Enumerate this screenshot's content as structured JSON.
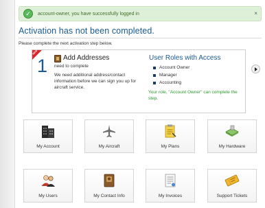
{
  "alert": {
    "message": "account-owner, you have successfully logged in",
    "close": "×"
  },
  "page": {
    "title": "Activation has not been completed.",
    "instruction": "Please complete the next activation step below."
  },
  "step": {
    "badge": "NEW",
    "number": "1",
    "title": "Add Addresses",
    "need": "need to complete",
    "description": "We need additional address/contact information before we can sign you up for aircraft service.",
    "roles_title": "User Roles with Access",
    "roles": [
      "Account Owner",
      "Manager",
      "Accounting"
    ],
    "role_note": "Your role, \"Account Owner\" can complete the step."
  },
  "tiles": [
    {
      "label": "My Account",
      "icon": "building-icon"
    },
    {
      "label": "My Aircraft",
      "icon": "airplane-icon"
    },
    {
      "label": "My Plans",
      "icon": "plans-icon"
    },
    {
      "label": "My Hardware",
      "icon": "hardware-icon"
    },
    {
      "label": "My Users",
      "icon": "users-icon"
    },
    {
      "label": "My Contact Info",
      "icon": "contact-book-icon"
    },
    {
      "label": "My Invoices",
      "icon": "invoice-icon"
    },
    {
      "label": "Support Tickets",
      "icon": "ticket-icon"
    }
  ],
  "colors": {
    "accent": "#1a5a96",
    "success_bg": "#dff0d8",
    "success_text": "#2e9a2e",
    "badge": "#d9262c"
  }
}
